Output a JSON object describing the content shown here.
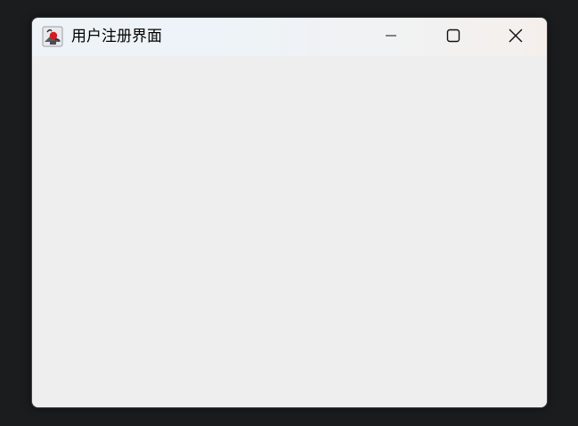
{
  "window": {
    "title": "用户注册界面",
    "app_icon": "java-app-icon",
    "controls": {
      "minimize": "minimize-icon",
      "maximize": "maximize-icon",
      "close": "close-icon"
    }
  },
  "colors": {
    "desktop": "#1b1c1e",
    "window_bg": "#eeeeee",
    "title_text": "#000000"
  }
}
